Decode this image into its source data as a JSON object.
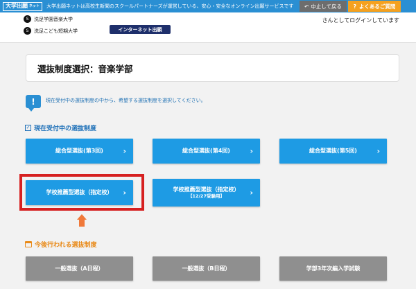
{
  "topbar": {
    "logo": "大学出願",
    "logo_sub": "ネット",
    "description": "大学出願ネットは高校生新聞のスクールパートナーズが運営している、安心・安全なオンライン出願サービスです",
    "back_button": "中止して戻る",
    "faq_button": "よくあるご質問"
  },
  "header": {
    "school1": "洗足学園音楽大学",
    "school2": "洗足こども短期大学",
    "school_mark": "S",
    "badge": "インターネット出願",
    "login_status": "さんとしてログインしています"
  },
  "page_title": "選抜制度選択：音楽学部",
  "notice": {
    "icon": "!",
    "text": "現在受付中の選抜制度の中から、希望する選抜制度を選択してください。"
  },
  "current_section": {
    "heading": "現在受付中の選抜制度",
    "buttons": [
      {
        "label": "総合型選抜(第3回)"
      },
      {
        "label": "総合型選抜(第4回)"
      },
      {
        "label": "総合型選抜(第5回)"
      },
      {
        "label": "学校推薦型選抜（指定校）"
      },
      {
        "label": "学校推薦型選抜（指定校）",
        "sub": "【12/27受験用】"
      }
    ]
  },
  "future_section": {
    "heading": "今後行われる選抜制度",
    "buttons": [
      {
        "label": "一般選抜（A日程）"
      },
      {
        "label": "一般選抜（B日程）"
      },
      {
        "label": "学部3年次編入学試験"
      }
    ]
  },
  "colors": {
    "brand_blue": "#2a8fd3",
    "button_blue": "#1e9be4",
    "highlight_red": "#d62020",
    "arrow_orange": "#f0793a",
    "future_orange": "#e98a18"
  },
  "icons": {
    "back": "back-arrow-icon",
    "faq": "question-icon",
    "notice": "exclamation-icon",
    "current": "checkbox-icon",
    "future": "calendar-icon",
    "button_chevron": "chevron-right-icon"
  }
}
